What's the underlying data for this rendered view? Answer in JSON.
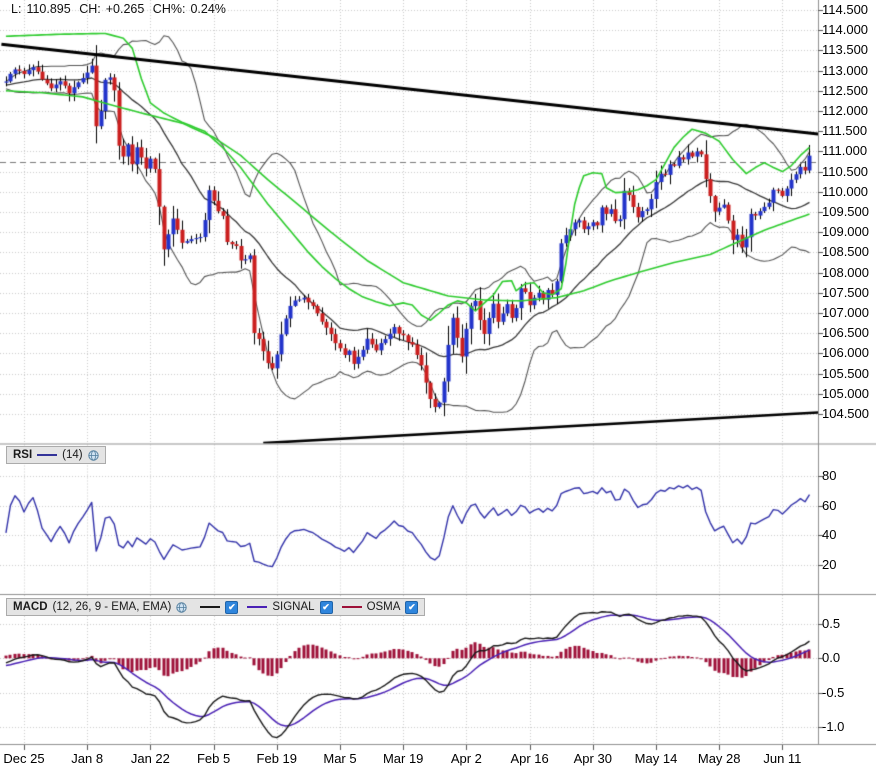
{
  "quote": {
    "l_label": "L:",
    "last": "110.895",
    "ch_label": "CH:",
    "change": "+0.265",
    "chp_label": "CH%:",
    "change_pct": "0.24%"
  },
  "rsi_header": {
    "title": "RSI",
    "params": "(14)"
  },
  "macd_header": {
    "title": "MACD",
    "params": "(12, 26, 9 - EMA, EMA)",
    "signal_label": "SIGNAL",
    "osma_label": "OSMA"
  },
  "price_axis_labels": [
    "114.500",
    "114.000",
    "113.500",
    "113.000",
    "112.500",
    "112.000",
    "111.500",
    "111.000",
    "110.500",
    "110.000",
    "109.500",
    "109.000",
    "108.500",
    "108.000",
    "107.500",
    "107.000",
    "106.500",
    "106.000",
    "105.500",
    "105.000",
    "104.500"
  ],
  "rsi_axis_labels": [
    "80",
    "60",
    "40",
    "20"
  ],
  "macd_axis_labels": [
    "0.5",
    "0.0",
    "-0.5",
    "-1.0"
  ],
  "date_axis_labels": [
    "Dec 25",
    "Jan 8",
    "Jan 22",
    "Feb 5",
    "Feb 19",
    "Mar 5",
    "Mar 19",
    "Apr 2",
    "Apr 16",
    "Apr 30",
    "May 14",
    "May 28",
    "Jun 11"
  ],
  "colors": {
    "candle_up": "#2334cb",
    "candle_down": "#cb1f1f",
    "wick": "#000000",
    "green_ema": "#2fcc2f",
    "bollinger_mid": "#3a3a3a",
    "bollinger_outer": "#565656",
    "rsi_line": "#3333aa",
    "macd_line": "#1a1a1a",
    "signal_line": "#4a21b5",
    "osma_bar": "#9e1139",
    "trendline": "#000000",
    "grid": "#cbcbcb",
    "separator": "#8f8f8f",
    "dashed_level": "#777777",
    "checkbox": "#2f85dc"
  },
  "chart_data": {
    "type": "candlestick",
    "panels": [
      "price",
      "rsi",
      "macd"
    ],
    "last_close": 110.895,
    "change": 0.265,
    "change_pct": 0.24,
    "x": {
      "labels": [
        "Dec 25",
        "Jan 8",
        "Jan 22",
        "Feb 5",
        "Feb 19",
        "Mar 5",
        "Mar 19",
        "Apr 2",
        "Apr 16",
        "Apr 30",
        "May 14",
        "May 28",
        "Jun 11"
      ],
      "bars_per_label": 14,
      "total_bars": 179,
      "first_label_bar": 4
    },
    "price_panel": {
      "ylim": [
        103.7,
        114.75
      ],
      "grid_step": 0.5,
      "axis_ticks": [
        114.5,
        114.0,
        113.5,
        113.0,
        112.5,
        112.0,
        111.5,
        111.0,
        110.5,
        110.0,
        109.5,
        109.0,
        108.5,
        108.0,
        107.5,
        107.0,
        106.5,
        106.0,
        105.5,
        105.0,
        104.5
      ],
      "dashed_level": 110.74,
      "close_path": [
        [
          0,
          112.75
        ],
        [
          2,
          113.05
        ],
        [
          4,
          112.9
        ],
        [
          6,
          113.1
        ],
        [
          8,
          112.8
        ],
        [
          10,
          112.55
        ],
        [
          12,
          112.75
        ],
        [
          14,
          112.45
        ],
        [
          16,
          112.7
        ],
        [
          18,
          112.95
        ],
        [
          19,
          113.1
        ],
        [
          20,
          111.6
        ],
        [
          21,
          112.0
        ],
        [
          22,
          112.75
        ],
        [
          23,
          112.85
        ],
        [
          24,
          112.5
        ],
        [
          25,
          111.15
        ],
        [
          26,
          110.9
        ],
        [
          27,
          111.15
        ],
        [
          28,
          110.7
        ],
        [
          29,
          111.1
        ],
        [
          30,
          110.85
        ],
        [
          31,
          110.6
        ],
        [
          32,
          110.8
        ],
        [
          33,
          110.55
        ],
        [
          34,
          109.65
        ],
        [
          35,
          108.6
        ],
        [
          36,
          108.95
        ],
        [
          37,
          109.35
        ],
        [
          39,
          108.75
        ],
        [
          41,
          108.8
        ],
        [
          43,
          108.9
        ],
        [
          44,
          109.3
        ],
        [
          45,
          110.05
        ],
        [
          47,
          109.5
        ],
        [
          48,
          109.4
        ],
        [
          49,
          108.75
        ],
        [
          50,
          108.7
        ],
        [
          51,
          108.65
        ],
        [
          52,
          108.3
        ],
        [
          53,
          108.35
        ],
        [
          54,
          108.4
        ],
        [
          55,
          106.5
        ],
        [
          56,
          106.35
        ],
        [
          57,
          106.05
        ],
        [
          58,
          105.75
        ],
        [
          59,
          105.6
        ],
        [
          60,
          105.95
        ],
        [
          61,
          106.5
        ],
        [
          62,
          106.85
        ],
        [
          63,
          107.2
        ],
        [
          64,
          107.3
        ],
        [
          66,
          107.35
        ],
        [
          68,
          107.15
        ],
        [
          70,
          106.8
        ],
        [
          72,
          106.45
        ],
        [
          74,
          106.1
        ],
        [
          75,
          105.95
        ],
        [
          76,
          106.05
        ],
        [
          77,
          105.75
        ],
        [
          78,
          105.9
        ],
        [
          79,
          106.1
        ],
        [
          80,
          106.35
        ],
        [
          81,
          106.2
        ],
        [
          82,
          106.1
        ],
        [
          83,
          106.25
        ],
        [
          84,
          106.35
        ],
        [
          85,
          106.5
        ],
        [
          86,
          106.65
        ],
        [
          87,
          106.5
        ],
        [
          88,
          106.45
        ],
        [
          89,
          106.3
        ],
        [
          90,
          106.2
        ],
        [
          91,
          105.95
        ],
        [
          92,
          105.7
        ],
        [
          93,
          105.25
        ],
        [
          94,
          104.85
        ],
        [
          95,
          104.7
        ],
        [
          96,
          104.8
        ],
        [
          97,
          105.3
        ],
        [
          98,
          106.2
        ],
        [
          99,
          106.9
        ],
        [
          100,
          106.4
        ],
        [
          101,
          105.9
        ],
        [
          102,
          106.6
        ],
        [
          103,
          107.2
        ],
        [
          104,
          107.3
        ],
        [
          105,
          106.85
        ],
        [
          106,
          106.5
        ],
        [
          107,
          106.9
        ],
        [
          108,
          107.25
        ],
        [
          109,
          106.8
        ],
        [
          110,
          107.0
        ],
        [
          111,
          107.2
        ],
        [
          112,
          106.9
        ],
        [
          113,
          107.1
        ],
        [
          114,
          107.6
        ],
        [
          115,
          107.5
        ],
        [
          116,
          107.2
        ],
        [
          117,
          107.35
        ],
        [
          118,
          107.5
        ],
        [
          119,
          107.3
        ],
        [
          120,
          107.55
        ],
        [
          121,
          107.45
        ],
        [
          122,
          107.8
        ],
        [
          123,
          108.7
        ],
        [
          124,
          108.9
        ],
        [
          125,
          109.1
        ],
        [
          126,
          109.25
        ],
        [
          127,
          109.3
        ],
        [
          128,
          109.05
        ],
        [
          129,
          109.15
        ],
        [
          130,
          109.25
        ],
        [
          131,
          109.15
        ],
        [
          132,
          109.6
        ],
        [
          133,
          109.45
        ],
        [
          134,
          109.55
        ],
        [
          135,
          109.3
        ],
        [
          136,
          109.35
        ],
        [
          137,
          110.0
        ],
        [
          138,
          109.9
        ],
        [
          139,
          109.6
        ],
        [
          140,
          109.35
        ],
        [
          141,
          109.5
        ],
        [
          142,
          109.55
        ],
        [
          143,
          109.8
        ],
        [
          144,
          110.25
        ],
        [
          145,
          110.45
        ],
        [
          146,
          110.4
        ],
        [
          147,
          110.7
        ],
        [
          148,
          110.65
        ],
        [
          149,
          110.85
        ],
        [
          150,
          110.8
        ],
        [
          151,
          110.95
        ],
        [
          152,
          110.9
        ],
        [
          153,
          111.0
        ],
        [
          154,
          110.95
        ],
        [
          155,
          110.3
        ],
        [
          156,
          109.9
        ],
        [
          157,
          109.5
        ],
        [
          158,
          109.6
        ],
        [
          159,
          109.7
        ],
        [
          160,
          109.3
        ],
        [
          161,
          108.8
        ],
        [
          162,
          108.95
        ],
        [
          163,
          108.6
        ],
        [
          164,
          108.9
        ],
        [
          165,
          109.45
        ],
        [
          166,
          109.4
        ],
        [
          167,
          109.55
        ],
        [
          168,
          109.65
        ],
        [
          169,
          109.75
        ],
        [
          170,
          110.05
        ],
        [
          171,
          110.0
        ],
        [
          172,
          109.9
        ],
        [
          173,
          110.1
        ],
        [
          174,
          110.3
        ],
        [
          175,
          110.45
        ],
        [
          176,
          110.6
        ],
        [
          177,
          110.5
        ],
        [
          178,
          110.895
        ]
      ],
      "preroll": [
        [
          -40,
          113.8
        ],
        [
          -30,
          112.9
        ],
        [
          -22,
          112.5
        ],
        [
          -16,
          112.6
        ],
        [
          -10,
          112.7
        ],
        [
          -5,
          112.6
        ],
        [
          -1,
          112.7
        ]
      ],
      "bollinger": {
        "period": 20,
        "mult": 2
      },
      "ema_fast_path": [
        [
          0,
          113.85
        ],
        [
          12,
          113.9
        ],
        [
          22,
          113.92
        ],
        [
          26,
          113.8
        ],
        [
          28,
          113.55
        ],
        [
          30,
          112.8
        ],
        [
          32,
          112.2
        ],
        [
          35,
          111.95
        ],
        [
          39,
          111.72
        ],
        [
          44,
          111.5
        ],
        [
          48,
          111.1
        ],
        [
          52,
          110.6
        ],
        [
          55,
          110.15
        ],
        [
          58,
          109.7
        ],
        [
          61,
          109.3
        ],
        [
          64,
          108.9
        ],
        [
          67,
          108.5
        ],
        [
          70,
          108.15
        ],
        [
          73,
          107.85
        ],
        [
          76,
          107.6
        ],
        [
          79,
          107.4
        ],
        [
          82,
          107.28
        ],
        [
          85,
          107.18
        ],
        [
          88,
          107.25
        ],
        [
          90,
          107.2
        ],
        [
          92,
          106.95
        ],
        [
          94,
          106.82
        ],
        [
          96,
          107.0
        ],
        [
          98,
          107.2
        ],
        [
          100,
          107.3
        ],
        [
          102,
          107.25
        ],
        [
          104,
          107.05
        ],
        [
          106,
          107.25
        ],
        [
          108,
          107.45
        ],
        [
          110,
          107.78
        ],
        [
          112,
          107.8
        ],
        [
          113,
          107.55
        ],
        [
          115,
          107.72
        ],
        [
          117,
          107.75
        ],
        [
          119,
          107.5
        ],
        [
          121,
          107.45
        ],
        [
          123,
          107.6
        ],
        [
          124,
          108.2
        ],
        [
          125,
          109.0
        ],
        [
          126,
          109.7
        ],
        [
          127,
          110.1
        ],
        [
          128,
          110.4
        ],
        [
          130,
          110.47
        ],
        [
          132,
          110.45
        ],
        [
          133,
          110.1
        ],
        [
          135,
          109.98
        ],
        [
          138,
          110.0
        ],
        [
          140,
          110.05
        ],
        [
          142,
          110.15
        ],
        [
          144,
          110.3
        ],
        [
          146,
          110.7
        ],
        [
          148,
          111.1
        ],
        [
          150,
          111.35
        ],
        [
          152,
          111.55
        ],
        [
          155,
          111.45
        ],
        [
          158,
          111.25
        ],
        [
          161,
          110.8
        ],
        [
          164,
          110.45
        ],
        [
          166,
          110.6
        ],
        [
          168,
          110.72
        ],
        [
          170,
          110.6
        ],
        [
          172,
          110.5
        ],
        [
          174,
          110.65
        ],
        [
          176,
          110.9
        ],
        [
          178,
          111.1
        ]
      ],
      "ema_slow_path": [
        [
          0,
          112.5
        ],
        [
          8,
          112.45
        ],
        [
          17,
          112.35
        ],
        [
          25,
          112.1
        ],
        [
          30,
          111.95
        ],
        [
          39,
          111.7
        ],
        [
          46,
          111.35
        ],
        [
          52,
          110.9
        ],
        [
          58,
          110.3
        ],
        [
          64,
          109.75
        ],
        [
          72,
          109.0
        ],
        [
          80,
          108.3
        ],
        [
          88,
          107.75
        ],
        [
          98,
          107.42
        ],
        [
          106,
          107.32
        ],
        [
          114,
          107.3
        ],
        [
          122,
          107.38
        ],
        [
          128,
          107.55
        ],
        [
          134,
          107.8
        ],
        [
          140,
          108.0
        ],
        [
          148,
          108.25
        ],
        [
          156,
          108.45
        ],
        [
          162,
          108.75
        ],
        [
          168,
          109.05
        ],
        [
          173,
          109.25
        ],
        [
          178,
          109.45
        ]
      ],
      "trendline_upper": [
        [
          -1,
          113.65
        ],
        [
          180,
          111.43
        ]
      ],
      "trendline_lower": [
        [
          57,
          103.78
        ],
        [
          180,
          104.54
        ]
      ]
    },
    "rsi_panel": {
      "period": 14,
      "gridlines": [
        80,
        60,
        40,
        20
      ],
      "ylim": [
        0,
        100
      ]
    },
    "macd_panel": {
      "fast": 12,
      "slow": 26,
      "signal": 9,
      "gridlines": [
        0.5,
        0.0,
        -0.5,
        -1.0
      ],
      "ylim": [
        -1.35,
        0.85
      ]
    },
    "seed": 9
  }
}
